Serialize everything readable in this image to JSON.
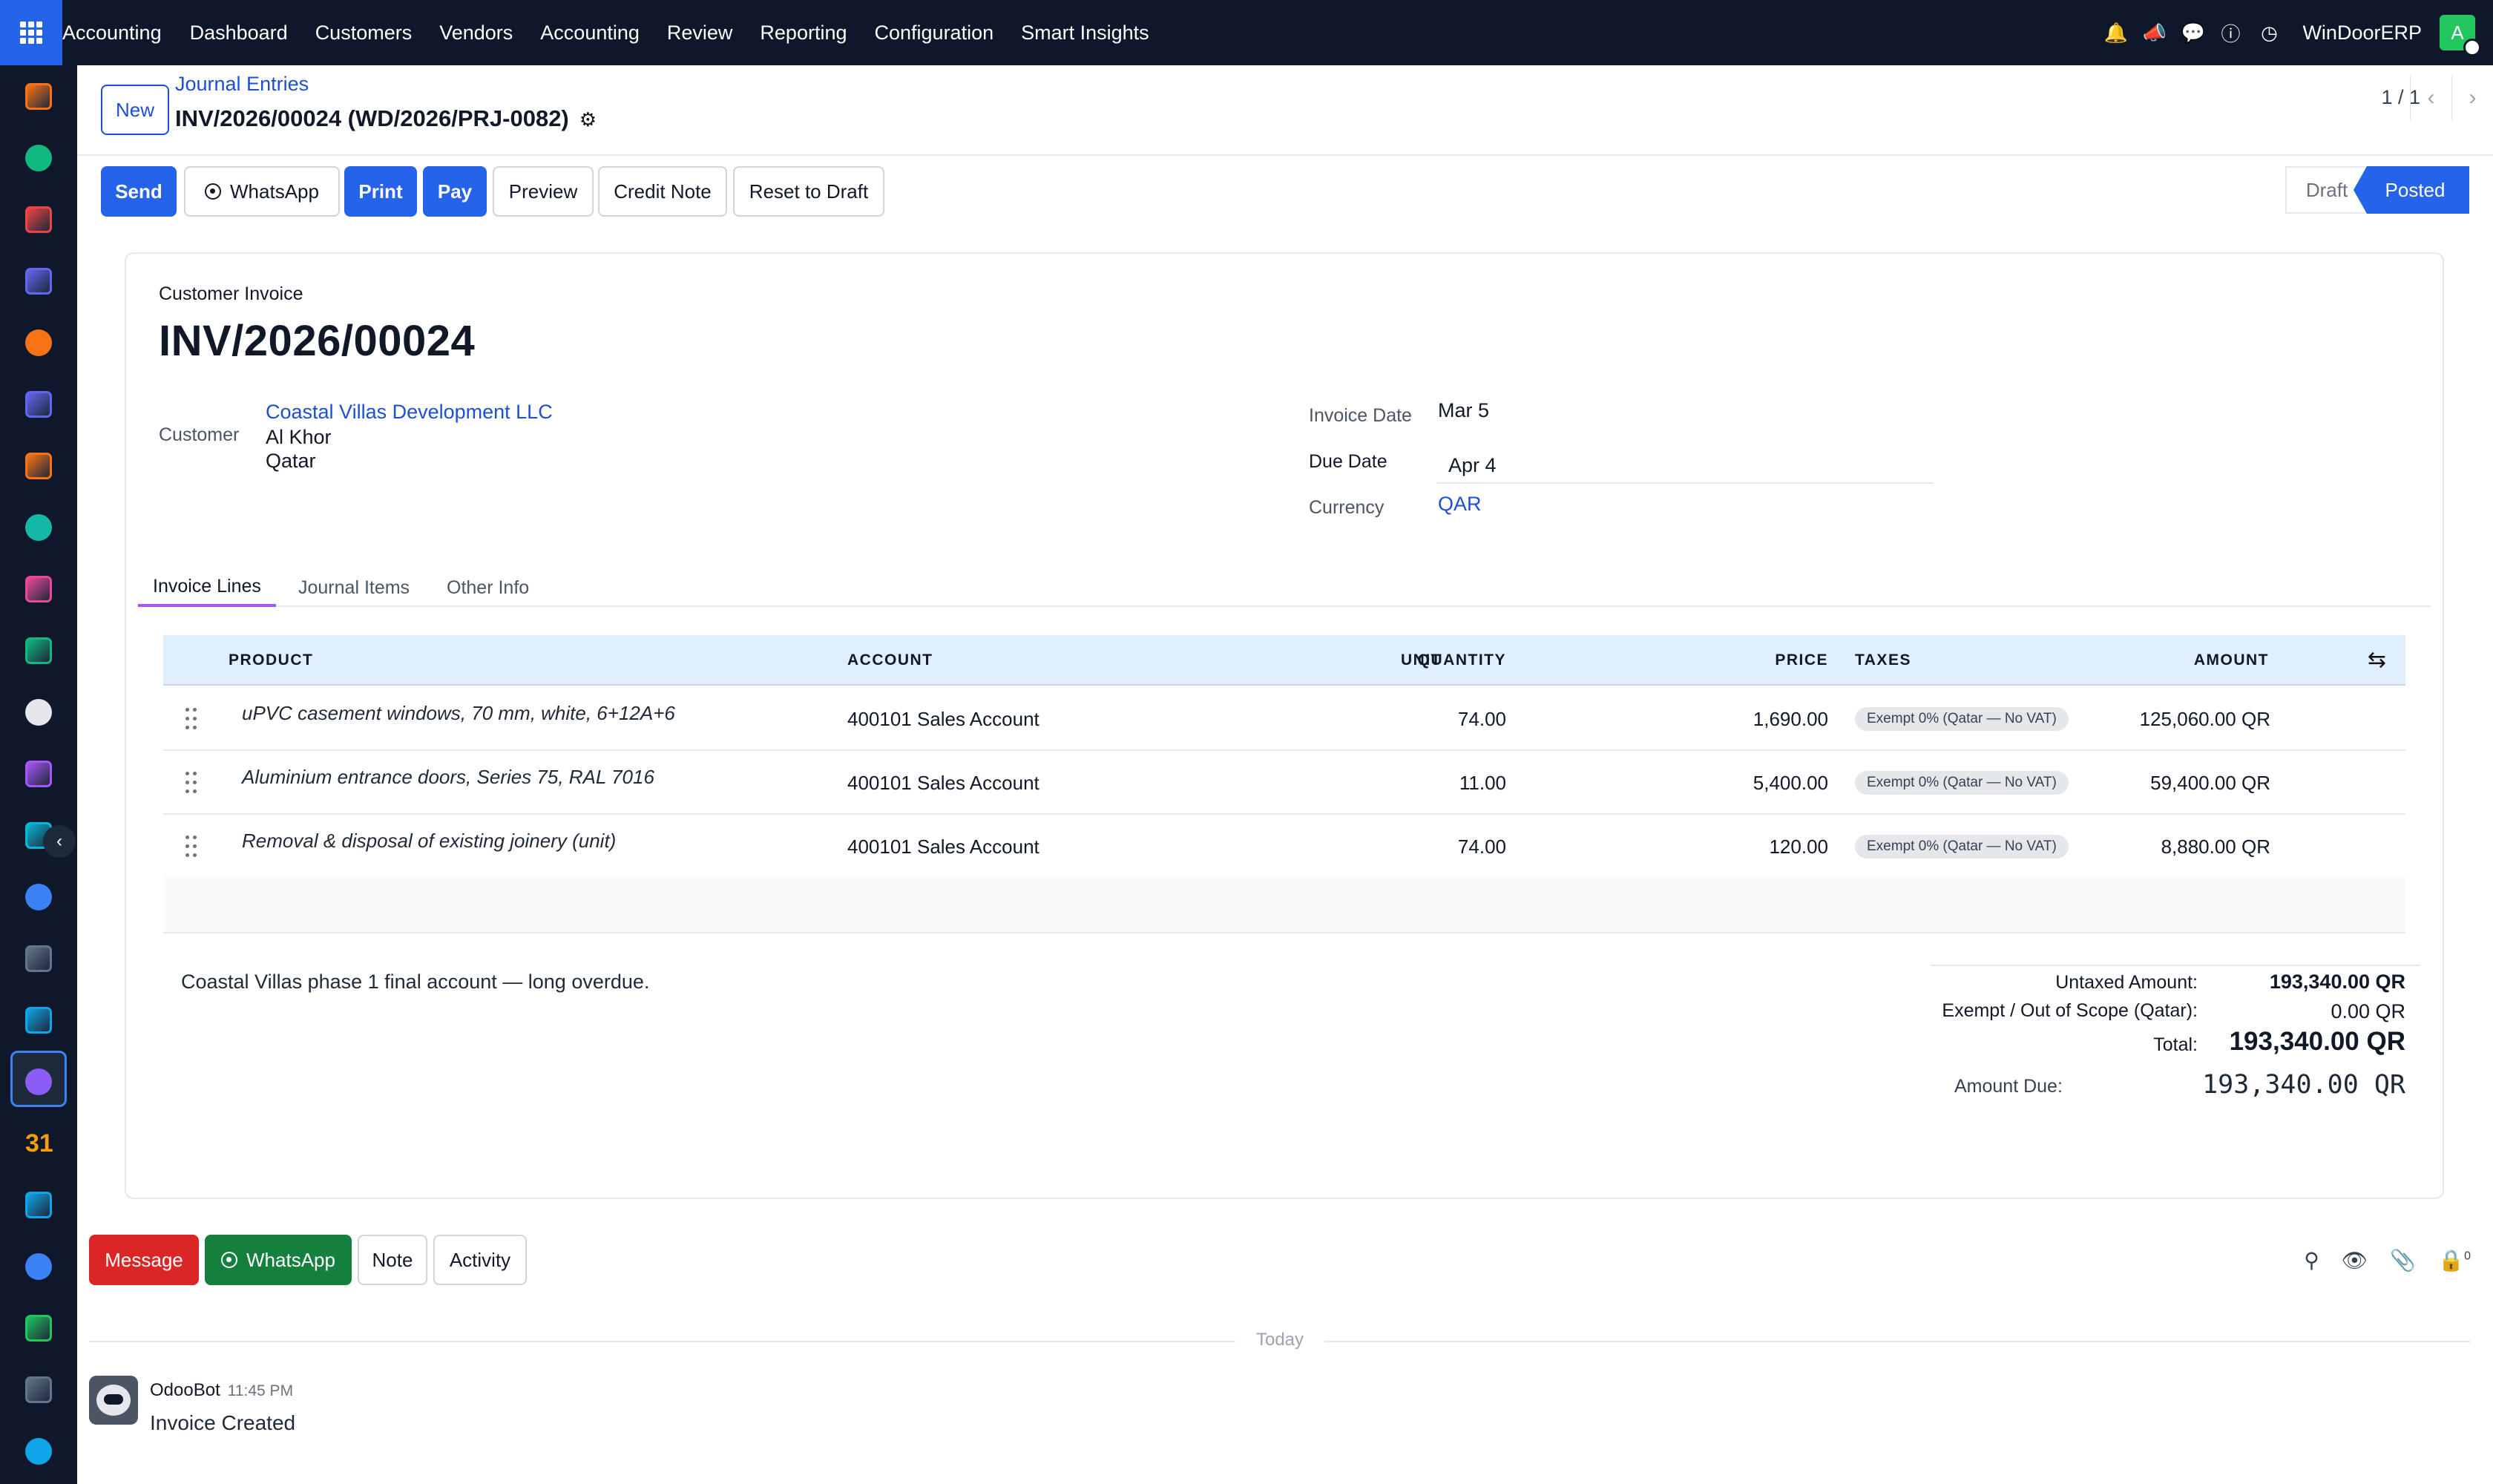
{
  "topbar": {
    "brand": "Accounting",
    "menu": [
      "Dashboard",
      "Customers",
      "Vendors",
      "Accounting",
      "Review",
      "Reporting",
      "Configuration",
      "Smart Insights"
    ],
    "company": "WinDoorERP",
    "avatar_letter": "A"
  },
  "rail": {
    "apps": [
      "documents-app-icon",
      "contacts-app-icon",
      "dashboards-app-icon",
      "discuss-app-icon",
      "livechat-app-icon",
      "mail-app-icon",
      "chat-app-icon",
      "sign-app-icon",
      "reports-app-icon",
      "employees-app-icon",
      "inventory-app-icon",
      "quality-app-icon",
      "project-app-icon",
      "knowledge-app-icon",
      "apps-store-icon",
      "invoicing-app-icon",
      "teams-app-icon",
      "calendar-app-icon",
      "planning-app-icon",
      "spreadsheet-app-icon",
      "whatsapp-app-icon",
      "timesheet-app-icon",
      "website-app-icon"
    ],
    "calendar_number": "31"
  },
  "control": {
    "new_label": "New",
    "breadcrumb": "Journal Entries",
    "record_title": "INV/2026/00024 (WD/2026/PRJ-0082)",
    "pager": "1 / 1"
  },
  "actions": {
    "send": "Send",
    "whatsapp": "WhatsApp",
    "print": "Print",
    "pay": "Pay",
    "preview": "Preview",
    "credit_note": "Credit Note",
    "reset_to_draft": "Reset to Draft"
  },
  "status": {
    "draft": "Draft",
    "posted": "Posted",
    "current": "Posted"
  },
  "invoice": {
    "type": "Customer Invoice",
    "number": "INV/2026/00024",
    "customer_label": "Customer",
    "customer_name": "Coastal Villas Development LLC",
    "customer_city": "Al Khor",
    "customer_country": "Qatar",
    "invoice_date_label": "Invoice Date",
    "invoice_date": "Mar 5",
    "due_date_label": "Due Date",
    "due_date": "Apr 4",
    "currency_label": "Currency",
    "currency": "QAR"
  },
  "tabs": [
    "Invoice Lines",
    "Journal Items",
    "Other Info"
  ],
  "lines": {
    "headers": {
      "product": "PRODUCT",
      "account": "ACCOUNT",
      "quantity": "QUANTITY",
      "unit": "UNIT",
      "price": "PRICE",
      "taxes": "TAXES",
      "amount": "AMOUNT"
    },
    "rows": [
      {
        "product": "uPVC casement windows, 70 mm, white, 6+12A+6",
        "account": "400101 Sales Account",
        "quantity": "74.00",
        "price": "1,690.00",
        "tax": "Exempt 0% (Qatar — No VAT)",
        "amount": "125,060.00 QR"
      },
      {
        "product": "Aluminium entrance doors, Series 75, RAL 7016",
        "account": "400101 Sales Account",
        "quantity": "11.00",
        "price": "5,400.00",
        "tax": "Exempt 0% (Qatar — No VAT)",
        "amount": "59,400.00 QR"
      },
      {
        "product": "Removal & disposal of existing joinery (unit)",
        "account": "400101 Sales Account",
        "quantity": "74.00",
        "price": "120.00",
        "tax": "Exempt 0% (Qatar — No VAT)",
        "amount": "8,880.00 QR"
      }
    ]
  },
  "narration": "Coastal Villas phase 1 final account — long overdue.",
  "totals": {
    "untaxed_label": "Untaxed Amount:",
    "untaxed": "193,340.00 QR",
    "exempt_label": "Exempt / Out of Scope (Qatar):",
    "exempt": "0.00 QR",
    "total_label": "Total:",
    "total": "193,340.00 QR",
    "due_label": "Amount Due:",
    "due": "193,340.00 QR"
  },
  "chatter": {
    "message": "Message",
    "whatsapp": "WhatsApp",
    "note": "Note",
    "activity": "Activity",
    "followers": "0",
    "today": "Today",
    "author": "OdooBot",
    "time": "11:45 PM",
    "body": "Invoice Created"
  },
  "colors": {
    "topbar": "#0f172a",
    "primary": "#2563eb",
    "link": "#1d4ed8",
    "message_button": "#dc2626",
    "whatsapp_button": "#15803d",
    "table_header": "#e0effe"
  }
}
